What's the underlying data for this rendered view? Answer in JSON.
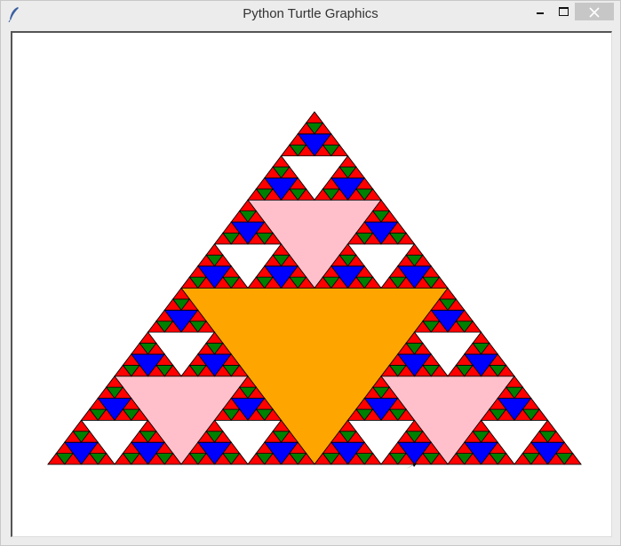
{
  "window": {
    "title": "Python Turtle Graphics",
    "icon": "feather-icon"
  },
  "controls": {
    "minimize": "minimize-icon",
    "maximize": "maximize-icon",
    "close": "close-icon"
  },
  "canvas": {
    "background": "#ffffff",
    "drawing": {
      "type": "sierpinski-triangle",
      "depth": 5,
      "level_colors": [
        "#ffa500",
        "#ffc0cb",
        "#ffffff",
        "#0000ff",
        "#008000",
        "#ff0000"
      ],
      "outline_color": "#000000"
    },
    "turtle": {
      "color": "#000000",
      "shape": "classic-arrow"
    }
  }
}
